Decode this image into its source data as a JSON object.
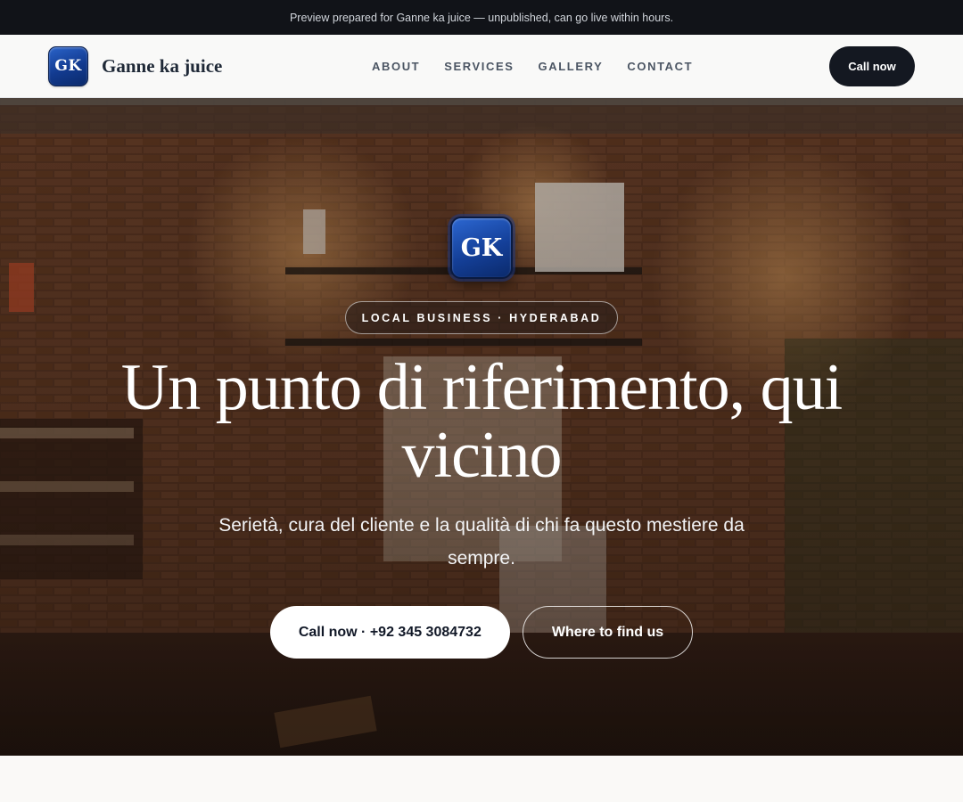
{
  "preview_banner": "Preview prepared for Ganne ka juice — unpublished, can go live within hours.",
  "header": {
    "logo_initials": "GK",
    "brand_name": "Ganne ka juice",
    "nav": [
      "ABOUT",
      "SERVICES",
      "GALLERY",
      "CONTACT"
    ],
    "cta_label": "Call now"
  },
  "hero": {
    "logo_initials": "GK",
    "badge": "LOCAL BUSINESS · HYDERABAD",
    "title": "Un punto di riferimento, qui vicino",
    "subtitle": "Serietà, cura del cliente e la qualità di chi fa questo mestiere da sempre.",
    "primary_button": "Call now · +92 345 3084732",
    "secondary_button": "Where to find us",
    "background_image": "coffee-shop-interior-photo"
  },
  "colors": {
    "brand_blue": "#143f98",
    "dark": "#141821",
    "preview_bar": "#111318"
  }
}
